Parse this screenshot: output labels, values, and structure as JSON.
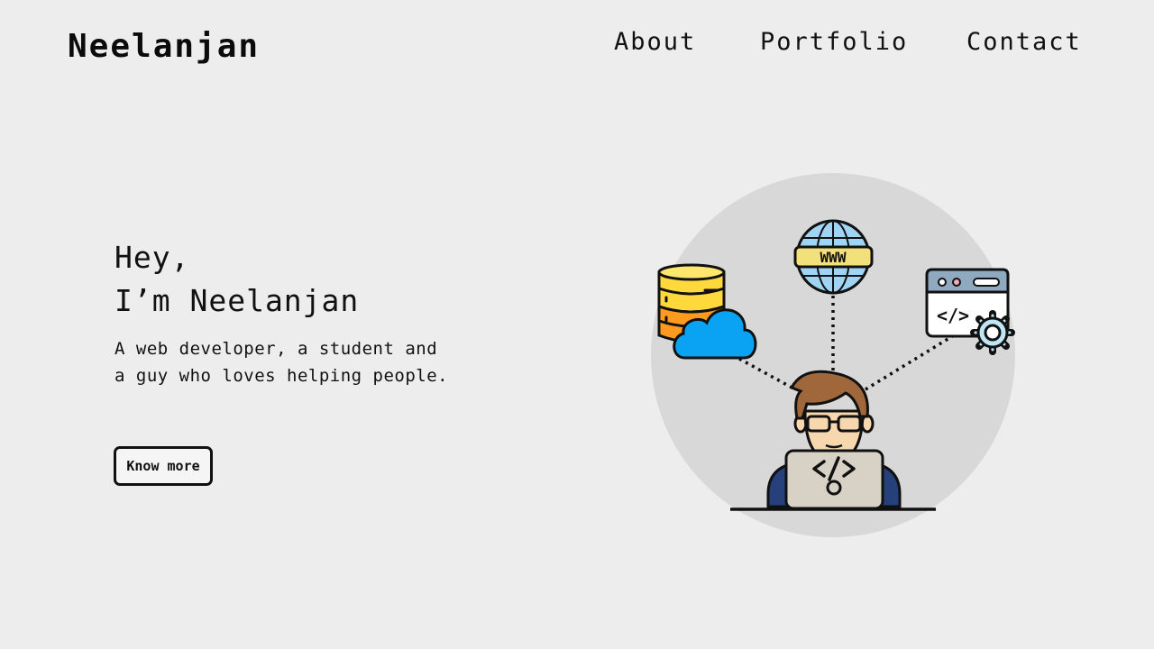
{
  "header": {
    "logo": "Neelanjan",
    "nav": [
      {
        "label": "About"
      },
      {
        "label": "Portfolio"
      },
      {
        "label": "Contact"
      }
    ]
  },
  "hero": {
    "greeting_line1": "Hey,",
    "greeting_line2": "I’m Neelanjan",
    "tagline": "A web developer, a student and a guy who loves helping people.",
    "button_label": "Know more"
  },
  "illustration": {
    "globe_label": "WWW",
    "code_symbol": "</>",
    "icons": [
      "database-icon",
      "cloud-icon",
      "globe-icon",
      "code-window-icon",
      "gear-icon",
      "developer-icon",
      "laptop-icon"
    ]
  },
  "colors": {
    "background": "#ededed",
    "circle": "#d8d8d8",
    "text": "#111111",
    "database_yellow": "#ffd93b",
    "database_orange": "#ff9a1f",
    "cloud_blue": "#0aa2f2",
    "globe_blue": "#9fd4f5",
    "globe_band": "#f2e07a",
    "window_header": "#8fa9c0",
    "gear_blue": "#bfe6f5",
    "hair_brown": "#a0673a",
    "skin": "#f6d7ae",
    "laptop_grey": "#d8d2c6",
    "shirt_navy": "#25407a"
  }
}
